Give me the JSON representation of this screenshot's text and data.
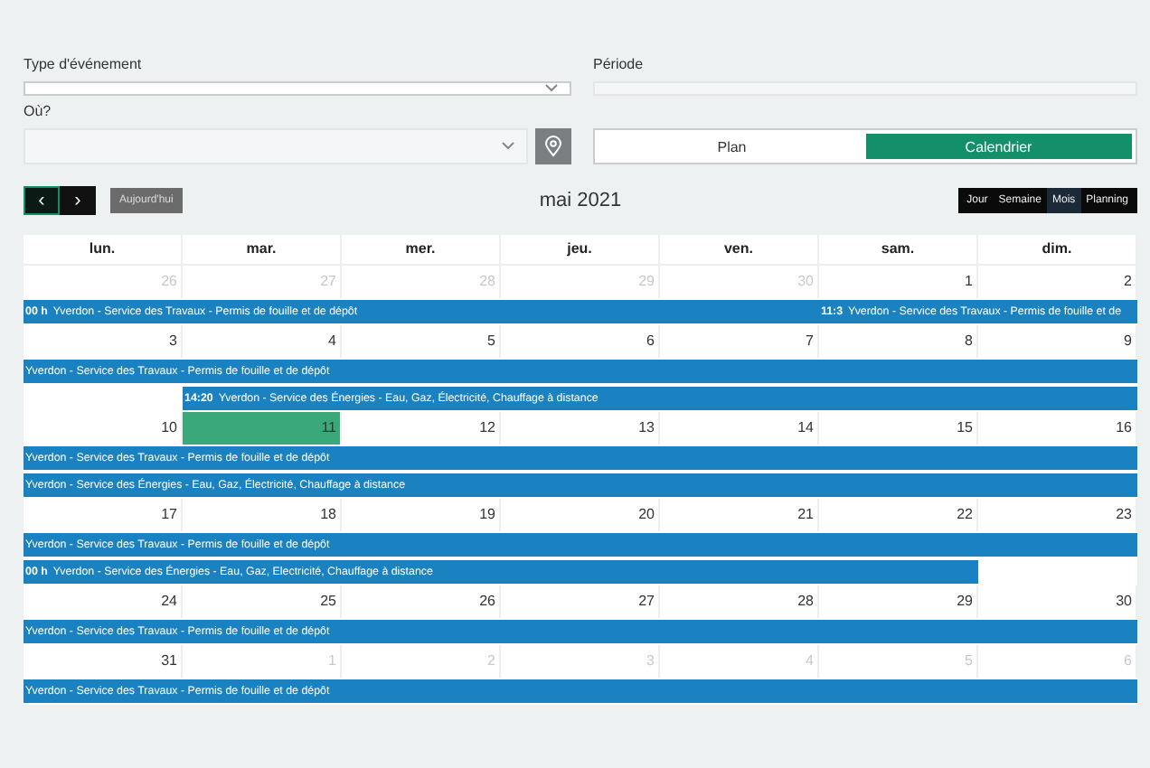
{
  "filters": {
    "event_type": {
      "label": "Type d'événement"
    },
    "period": {
      "label": "Période"
    },
    "where": {
      "label": "Où?"
    }
  },
  "display_toggle": [
    {
      "label": "Plan",
      "selected": false
    },
    {
      "label": "Calendrier",
      "selected": true
    }
  ],
  "toolbar": {
    "prev": "‹",
    "next": "›",
    "today": "Aujourd'hui",
    "title": "mai 2021",
    "views": [
      {
        "label": "Jour",
        "selected": false
      },
      {
        "label": "Semaine",
        "selected": false
      },
      {
        "label": "Mois",
        "selected": true
      },
      {
        "label": "Planning",
        "selected": false
      }
    ]
  },
  "weekdays": [
    "lun.",
    "mar.",
    "mer.",
    "jeu.",
    "ven.",
    "sam.",
    "dim."
  ],
  "weeks": [
    {
      "days": [
        {
          "number": "26",
          "other_month": true,
          "today": false
        },
        {
          "number": "27",
          "other_month": true,
          "today": false
        },
        {
          "number": "28",
          "other_month": true,
          "today": false
        },
        {
          "number": "29",
          "other_month": true,
          "today": false
        },
        {
          "number": "30",
          "other_month": true,
          "today": false
        },
        {
          "number": "1",
          "other_month": false,
          "today": false
        },
        {
          "number": "2",
          "other_month": false,
          "today": false
        }
      ],
      "lanes": [
        [
          {
            "kind": "event",
            "time": "00 h",
            "title": "Yverdon - Service des Travaux - Permis de fouille et de dépôt"
          },
          {
            "kind": "continued"
          },
          {
            "kind": "continued"
          },
          {
            "kind": "continued"
          },
          {
            "kind": "continued"
          },
          {
            "kind": "event",
            "time": "11:3",
            "title": "Yverdon - Service des Travaux - Permis de fouille et de"
          },
          {
            "kind": "continued"
          }
        ]
      ]
    },
    {
      "days": [
        {
          "number": "3",
          "other_month": false,
          "today": false
        },
        {
          "number": "4",
          "other_month": false,
          "today": false
        },
        {
          "number": "5",
          "other_month": false,
          "today": false
        },
        {
          "number": "6",
          "other_month": false,
          "today": false
        },
        {
          "number": "7",
          "other_month": false,
          "today": false
        },
        {
          "number": "8",
          "other_month": false,
          "today": false
        },
        {
          "number": "9",
          "other_month": false,
          "today": false
        }
      ],
      "lanes": [
        [
          {
            "kind": "event",
            "title": "Yverdon - Service des Travaux - Permis de fouille et de dépôt"
          },
          {
            "kind": "continued"
          },
          {
            "kind": "continued"
          },
          {
            "kind": "continued"
          },
          {
            "kind": "continued"
          },
          {
            "kind": "continued"
          },
          {
            "kind": "continued"
          }
        ],
        [
          {
            "kind": "empty"
          },
          {
            "kind": "event",
            "time": "14:20",
            "title": "Yverdon - Service des Énergies - Eau, Gaz, Électricité, Chauffage à distance"
          },
          {
            "kind": "continued"
          },
          {
            "kind": "continued"
          },
          {
            "kind": "continued"
          },
          {
            "kind": "continued"
          },
          {
            "kind": "continued"
          }
        ]
      ]
    },
    {
      "days": [
        {
          "number": "10",
          "other_month": false,
          "today": false
        },
        {
          "number": "11",
          "other_month": false,
          "today": true
        },
        {
          "number": "12",
          "other_month": false,
          "today": false
        },
        {
          "number": "13",
          "other_month": false,
          "today": false
        },
        {
          "number": "14",
          "other_month": false,
          "today": false
        },
        {
          "number": "15",
          "other_month": false,
          "today": false
        },
        {
          "number": "16",
          "other_month": false,
          "today": false
        }
      ],
      "lanes": [
        [
          {
            "kind": "event",
            "title": "Yverdon - Service des Travaux - Permis de fouille et de dépôt"
          },
          {
            "kind": "continued"
          },
          {
            "kind": "continued"
          },
          {
            "kind": "continued"
          },
          {
            "kind": "continued"
          },
          {
            "kind": "continued"
          },
          {
            "kind": "continued"
          }
        ],
        [
          {
            "kind": "event",
            "title": "Yverdon - Service des Énergies - Eau, Gaz, Électricité, Chauffage à distance"
          },
          {
            "kind": "continued"
          },
          {
            "kind": "continued"
          },
          {
            "kind": "continued"
          },
          {
            "kind": "continued"
          },
          {
            "kind": "continued"
          },
          {
            "kind": "continued"
          }
        ]
      ]
    },
    {
      "days": [
        {
          "number": "17",
          "other_month": false,
          "today": false
        },
        {
          "number": "18",
          "other_month": false,
          "today": false
        },
        {
          "number": "19",
          "other_month": false,
          "today": false
        },
        {
          "number": "20",
          "other_month": false,
          "today": false
        },
        {
          "number": "21",
          "other_month": false,
          "today": false
        },
        {
          "number": "22",
          "other_month": false,
          "today": false
        },
        {
          "number": "23",
          "other_month": false,
          "today": false
        }
      ],
      "lanes": [
        [
          {
            "kind": "event",
            "title": "Yverdon - Service des Travaux - Permis de fouille et de dépôt"
          },
          {
            "kind": "continued"
          },
          {
            "kind": "continued"
          },
          {
            "kind": "continued"
          },
          {
            "kind": "continued"
          },
          {
            "kind": "continued"
          },
          {
            "kind": "continued"
          }
        ],
        [
          {
            "kind": "event",
            "time": "00 h",
            "title": "Yverdon - Service des Énergies - Eau, Gaz, Electricité, Chauffage à distance"
          },
          {
            "kind": "continued"
          },
          {
            "kind": "continued"
          },
          {
            "kind": "continued"
          },
          {
            "kind": "continued"
          },
          {
            "kind": "continued"
          },
          {
            "kind": "empty"
          }
        ]
      ]
    },
    {
      "days": [
        {
          "number": "24",
          "other_month": false,
          "today": false
        },
        {
          "number": "25",
          "other_month": false,
          "today": false
        },
        {
          "number": "26",
          "other_month": false,
          "today": false
        },
        {
          "number": "27",
          "other_month": false,
          "today": false
        },
        {
          "number": "28",
          "other_month": false,
          "today": false
        },
        {
          "number": "29",
          "other_month": false,
          "today": false
        },
        {
          "number": "30",
          "other_month": false,
          "today": false
        }
      ],
      "lanes": [
        [
          {
            "kind": "event",
            "title": "Yverdon - Service des Travaux - Permis de fouille et de dépôt"
          },
          {
            "kind": "continued"
          },
          {
            "kind": "continued"
          },
          {
            "kind": "continued"
          },
          {
            "kind": "continued"
          },
          {
            "kind": "continued"
          },
          {
            "kind": "continued"
          }
        ]
      ]
    },
    {
      "days": [
        {
          "number": "31",
          "other_month": false,
          "today": false
        },
        {
          "number": "1",
          "other_month": true,
          "today": false
        },
        {
          "number": "2",
          "other_month": true,
          "today": false
        },
        {
          "number": "3",
          "other_month": true,
          "today": false
        },
        {
          "number": "4",
          "other_month": true,
          "today": false
        },
        {
          "number": "5",
          "other_month": true,
          "today": false
        },
        {
          "number": "6",
          "other_month": true,
          "today": false
        }
      ],
      "lanes": [
        [
          {
            "kind": "event",
            "title": "Yverdon - Service des Travaux - Permis de fouille et de dépôt"
          },
          {
            "kind": "continued"
          },
          {
            "kind": "continued"
          },
          {
            "kind": "continued"
          },
          {
            "kind": "continued"
          },
          {
            "kind": "continued"
          },
          {
            "kind": "continued"
          }
        ]
      ]
    }
  ]
}
